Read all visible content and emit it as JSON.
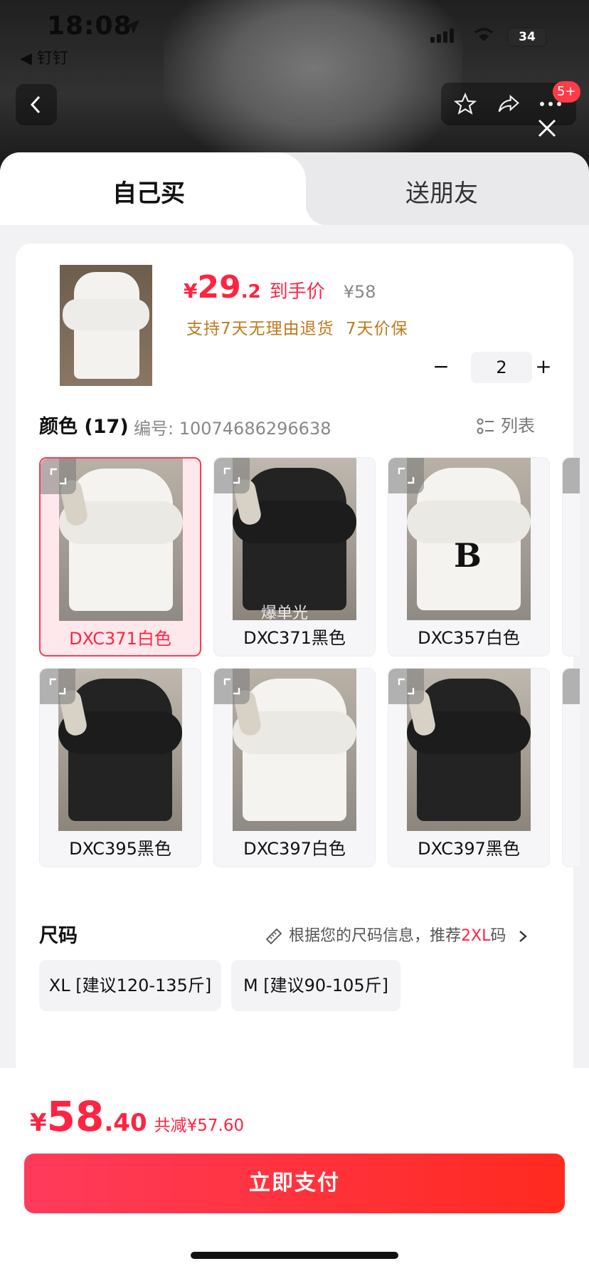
{
  "status_bar": {
    "time": "18:08",
    "back_app": "◀ 钉钉",
    "battery": "34"
  },
  "top_nav": {
    "badge": "5+"
  },
  "tabs": {
    "self_buy": "自己买",
    "gift": "送朋友"
  },
  "product": {
    "price_currency": "¥",
    "price_int": "29",
    "price_dec": ".2",
    "price_label": "到手价",
    "original_price": "¥58",
    "promo": "支持7天无理由退货 7天价保",
    "quantity": "2"
  },
  "color": {
    "heading": "颜色 (17)",
    "code_label": "编号: 10074686296638",
    "list_label": "列表",
    "options": [
      {
        "label": "DXC371白色",
        "selected": true
      },
      {
        "label": "DXC371黑色",
        "selected": false,
        "overlay": "爆单光"
      },
      {
        "label": "DXC357白色",
        "selected": false
      },
      {
        "label": "DXC395黑色",
        "selected": false
      },
      {
        "label": "DXC397白色",
        "selected": false
      },
      {
        "label": "DXC397黑色",
        "selected": false
      }
    ]
  },
  "size": {
    "heading": "尺码",
    "tip_prefix": "根据您的尺码信息，推荐",
    "tip_highlight": "2XL",
    "tip_suffix": "码",
    "options": [
      "XL [建议120-135斤]",
      "M [建议90-105斤]"
    ]
  },
  "footer": {
    "currency": "¥",
    "total_int": "58",
    "total_dec": ".40",
    "saved": "共减¥57.60",
    "pay_label": "立即支付"
  },
  "colors": {
    "accent": "#ff2442",
    "promo": "#c07a1e"
  }
}
